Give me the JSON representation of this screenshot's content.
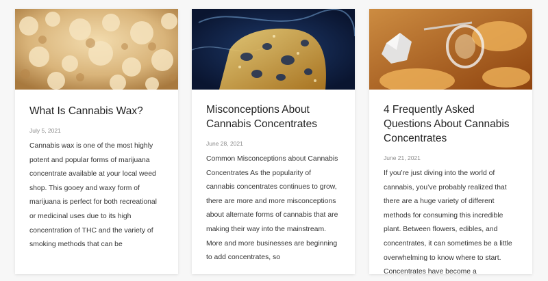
{
  "posts": [
    {
      "image_alt": "cannabis wax close-up",
      "title": "What Is Cannabis Wax?",
      "date": "July 5, 2021",
      "excerpt": "Cannabis wax is one of the most highly potent and popular forms of marijuana concentrate available at your local weed shop. This gooey and waxy form of marijuana is perfect for both recreational or medicinal uses due to its high concentration of THC and the variety of smoking methods that can be"
    },
    {
      "image_alt": "shatter concentrate with smoke",
      "title": "Misconceptions About Cannabis Concentrates",
      "date": "June 28, 2021",
      "excerpt": "Common Misconceptions about Cannabis Concentrates As the popularity of cannabis concentrates continues to grow, there are more and more misconceptions about alternate forms of cannabis that are making their way into the mainstream. More and more businesses are beginning to add concentrates, so"
    },
    {
      "image_alt": "amber concentrate with crystals and glass jar",
      "title": "4 Frequently Asked Questions About Cannabis Concentrates",
      "date": "June 21, 2021",
      "excerpt": "If you’re just diving into the world of cannabis, you’ve probably realized that there are a huge variety of different methods for consuming this incredible plant. Between flowers, edibles, and concentrates, it can sometimes be a little overwhelming to know where to start. Concentrates have become a"
    }
  ],
  "colors": {
    "background": "#f7f7f7",
    "card": "#ffffff",
    "title": "#222222",
    "date": "#8a8a8a",
    "excerpt": "#333333"
  }
}
